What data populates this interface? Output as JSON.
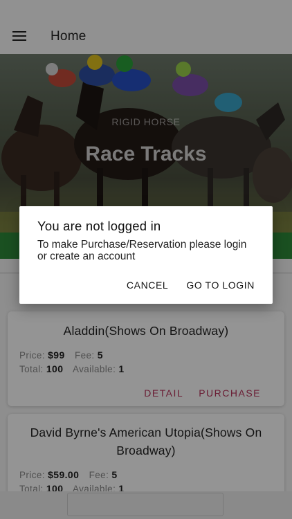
{
  "appbar": {
    "title": "Home",
    "menu_icon": "hamburger-menu-icon"
  },
  "hero": {
    "subtitle": "RIGID HORSE",
    "title": "Race Tracks"
  },
  "cards": [
    {
      "title": "Aladdin(Shows On Broadway)",
      "price_label": "Price:",
      "price": "$99",
      "fee_label": "Fee:",
      "fee": "5",
      "total_label": "Total:",
      "total": "100",
      "available_label": "Available:",
      "available": "1",
      "detail_label": "DETAIL",
      "purchase_label": "PURCHASE"
    },
    {
      "title": "David Byrne's American Utopia(Shows On Broadway)",
      "price_label": "Price:",
      "price": "$59.00",
      "fee_label": "Fee:",
      "fee": "5",
      "total_label": "Total:",
      "total": "100",
      "available_label": "Available:",
      "available": "1"
    }
  ],
  "dialog": {
    "title": "You are not logged in",
    "message": "To make Purchase/Reservation please login or create an account",
    "cancel_label": "CANCEL",
    "login_label": "GO TO LOGIN"
  },
  "colors": {
    "accent": "#b7335a",
    "green_bar": "#2e8b3a",
    "scrim": "rgba(0,0,0,0.42)"
  }
}
